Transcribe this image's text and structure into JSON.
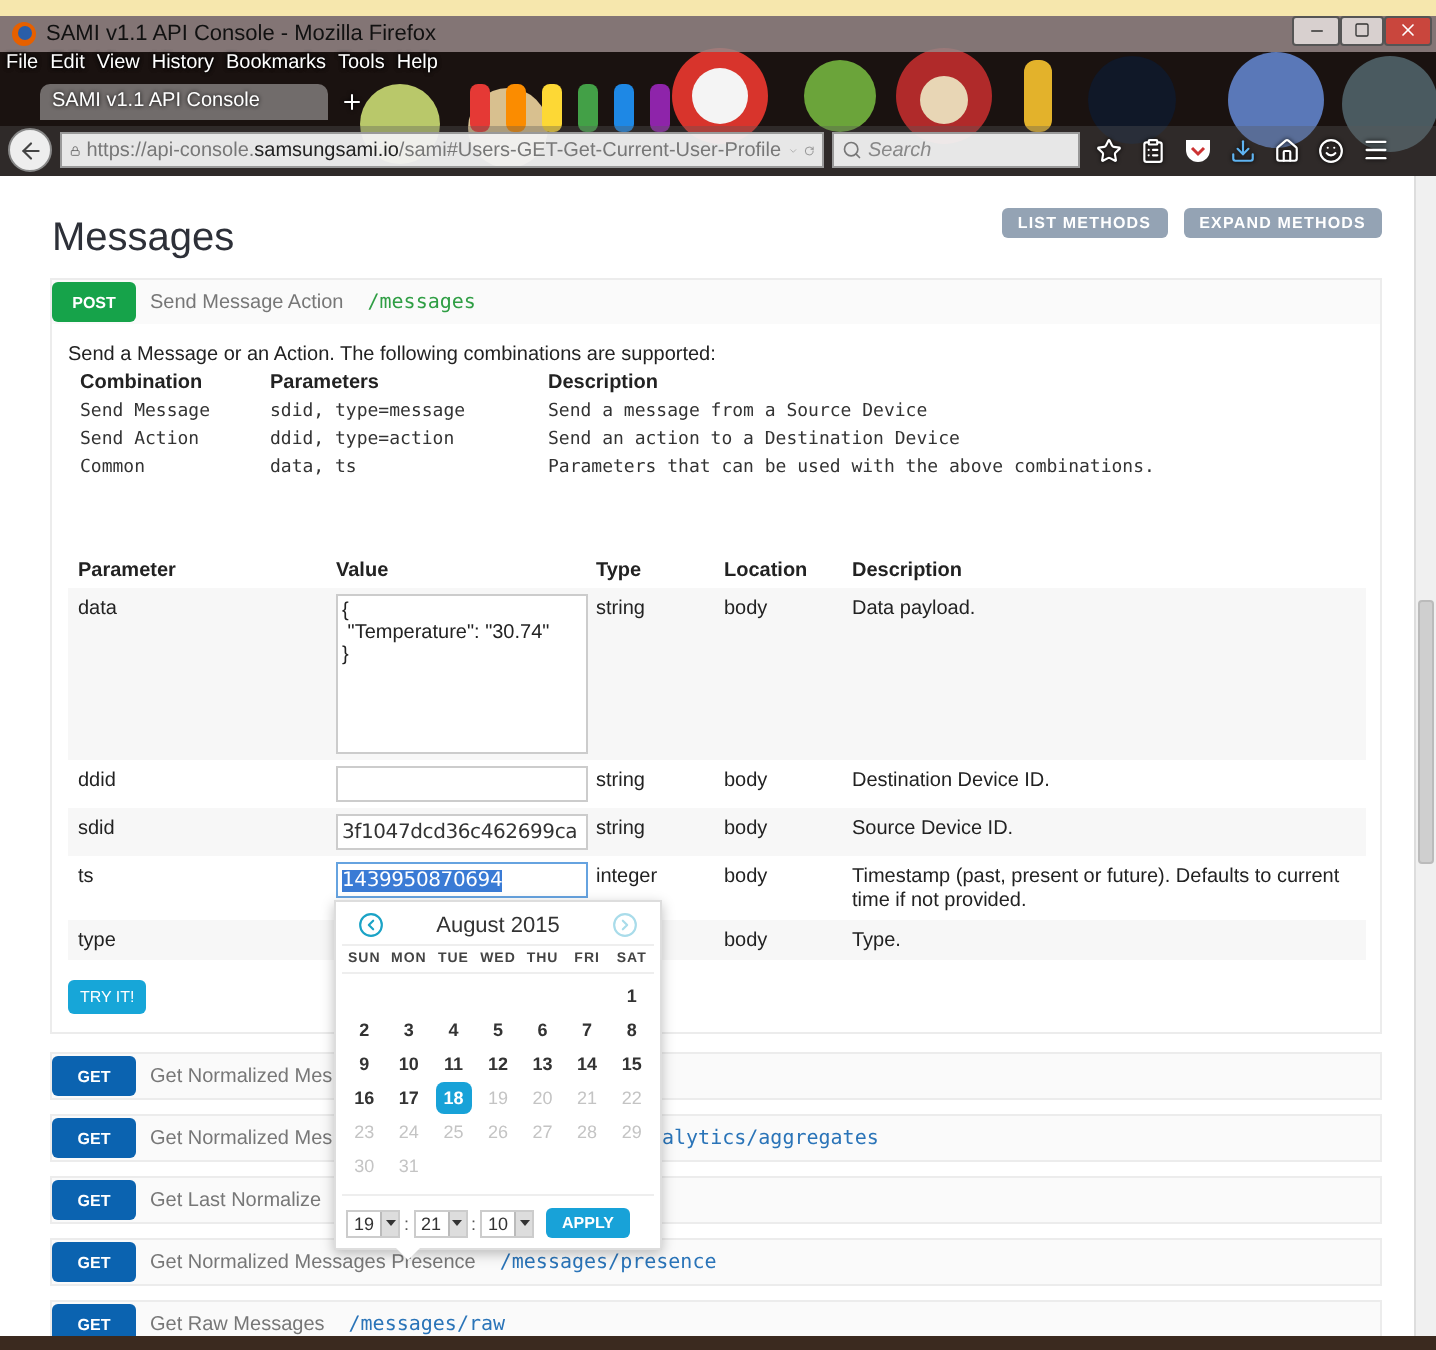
{
  "window": {
    "title": "SAMI v1.1 API Console - Mozilla Firefox"
  },
  "menu": [
    "File",
    "Edit",
    "View",
    "History",
    "Bookmarks",
    "Tools",
    "Help"
  ],
  "tabs": [
    {
      "label": "SAMI v1.1 API Console",
      "selected": true
    }
  ],
  "address_bar": {
    "url_scheme": "https://api-console.",
    "url_host": "samsungsami.io",
    "url_path": "/sami#Users-GET-Get-Current-User-Profile"
  },
  "search": {
    "placeholder": "Search"
  },
  "page": {
    "title": "Messages",
    "buttons": [
      "LIST METHODS",
      "EXPAND METHODS"
    ]
  },
  "expanded_operation": {
    "method": "POST",
    "title": "Send Message Action",
    "path": "/messages",
    "description": "Send a Message or an Action. The following combinations are supported:",
    "combination_columns": [
      "Combination",
      "Parameters",
      "Description"
    ],
    "combinations": [
      [
        "Send Message",
        "sdid, type=message",
        "Send a message from a Source Device"
      ],
      [
        "Send Action",
        "ddid, type=action",
        "Send an action to a Destination Device"
      ],
      [
        "Common",
        "data, ts",
        "Parameters that can be used with the above combinations."
      ]
    ],
    "parameter_columns": [
      "Parameter",
      "Value",
      "Type",
      "Location",
      "Description"
    ],
    "parameters": [
      {
        "kind": "textarea",
        "name": "data",
        "value": "{\n \"Temperature\": \"30.74\"\n}",
        "type": "string",
        "location": "body",
        "description": "Data payload."
      },
      {
        "kind": "input",
        "name": "ddid",
        "type": "string",
        "location": "body",
        "description": "Destination Device ID."
      },
      {
        "kind": "input",
        "name": "sdid",
        "value": "3f1047dcd36c462699ca",
        "type": "string",
        "location": "body",
        "description": "Source Device ID."
      },
      {
        "kind": "input",
        "name": "ts",
        "value": "1439950870694",
        "text_selected": true,
        "type": "integer",
        "location": "body",
        "description": "Timestamp (past, present or future). Defaults to current time if not provided."
      },
      {
        "kind": "covered",
        "name": "type",
        "location": "body",
        "description": "Type."
      }
    ],
    "try_button": "TRY IT!"
  },
  "datepicker": {
    "month": "August 2015",
    "next_disabled": true,
    "weekdays": [
      "SUN",
      "MON",
      "TUE",
      "WED",
      "THU",
      "FRI",
      "SAT"
    ],
    "weeks": [
      {
        "align_end": true,
        "days": [
          {
            "label": "1",
            "disabled": false,
            "selected": false
          }
        ]
      },
      {
        "days": [
          {
            "label": "2",
            "disabled": false,
            "selected": false
          },
          {
            "label": "3",
            "disabled": false,
            "selected": false
          },
          {
            "label": "4",
            "disabled": false,
            "selected": false
          },
          {
            "label": "5",
            "disabled": false,
            "selected": false
          },
          {
            "label": "6",
            "disabled": false,
            "selected": false
          },
          {
            "label": "7",
            "disabled": false,
            "selected": false
          },
          {
            "label": "8",
            "disabled": false,
            "selected": false
          }
        ]
      },
      {
        "days": [
          {
            "label": "9",
            "disabled": false,
            "selected": false
          },
          {
            "label": "10",
            "disabled": false,
            "selected": false
          },
          {
            "label": "11",
            "disabled": false,
            "selected": false
          },
          {
            "label": "12",
            "disabled": false,
            "selected": false
          },
          {
            "label": "13",
            "disabled": false,
            "selected": false
          },
          {
            "label": "14",
            "disabled": false,
            "selected": false
          },
          {
            "label": "15",
            "disabled": false,
            "selected": false
          }
        ]
      },
      {
        "days": [
          {
            "label": "16",
            "disabled": false,
            "selected": false
          },
          {
            "label": "17",
            "disabled": false,
            "selected": false
          },
          {
            "label": "18",
            "disabled": false,
            "selected": true
          },
          {
            "label": "19",
            "disabled": true,
            "selected": false
          },
          {
            "label": "20",
            "disabled": true,
            "selected": false
          },
          {
            "label": "21",
            "disabled": true,
            "selected": false
          },
          {
            "label": "22",
            "disabled": true,
            "selected": false
          }
        ]
      },
      {
        "days": [
          {
            "label": "23",
            "disabled": true,
            "selected": false
          },
          {
            "label": "24",
            "disabled": true,
            "selected": false
          },
          {
            "label": "25",
            "disabled": true,
            "selected": false
          },
          {
            "label": "26",
            "disabled": true,
            "selected": false
          },
          {
            "label": "27",
            "disabled": true,
            "selected": false
          },
          {
            "label": "28",
            "disabled": true,
            "selected": false
          },
          {
            "label": "29",
            "disabled": true,
            "selected": false
          }
        ]
      },
      {
        "align_end": false,
        "days": [
          {
            "label": "30",
            "disabled": true,
            "selected": false
          },
          {
            "label": "31",
            "disabled": true,
            "selected": false
          }
        ]
      }
    ],
    "time": [
      {
        "kind": "select",
        "value": "19"
      },
      {
        "kind": "separator",
        "text": ":"
      },
      {
        "kind": "select",
        "value": "21"
      },
      {
        "kind": "separator",
        "text": ":"
      },
      {
        "kind": "select",
        "value": "10"
      }
    ],
    "apply_button": "APPLY"
  },
  "operations": [
    {
      "method": "GET",
      "title": "Get Normalized Mes",
      "covered": true
    },
    {
      "method": "GET",
      "title": "Get Normalized Mes",
      "path": "alytics/aggregates",
      "covered": true
    },
    {
      "method": "GET",
      "title": "Get Last Normalize",
      "covered": true
    },
    {
      "method": "GET",
      "title": "Get Normalized Messages Presence",
      "path": "/messages/presence",
      "covered": false
    },
    {
      "method": "GET",
      "title": "Get Raw Messages",
      "path": "/messages/raw",
      "covered": false
    }
  ]
}
